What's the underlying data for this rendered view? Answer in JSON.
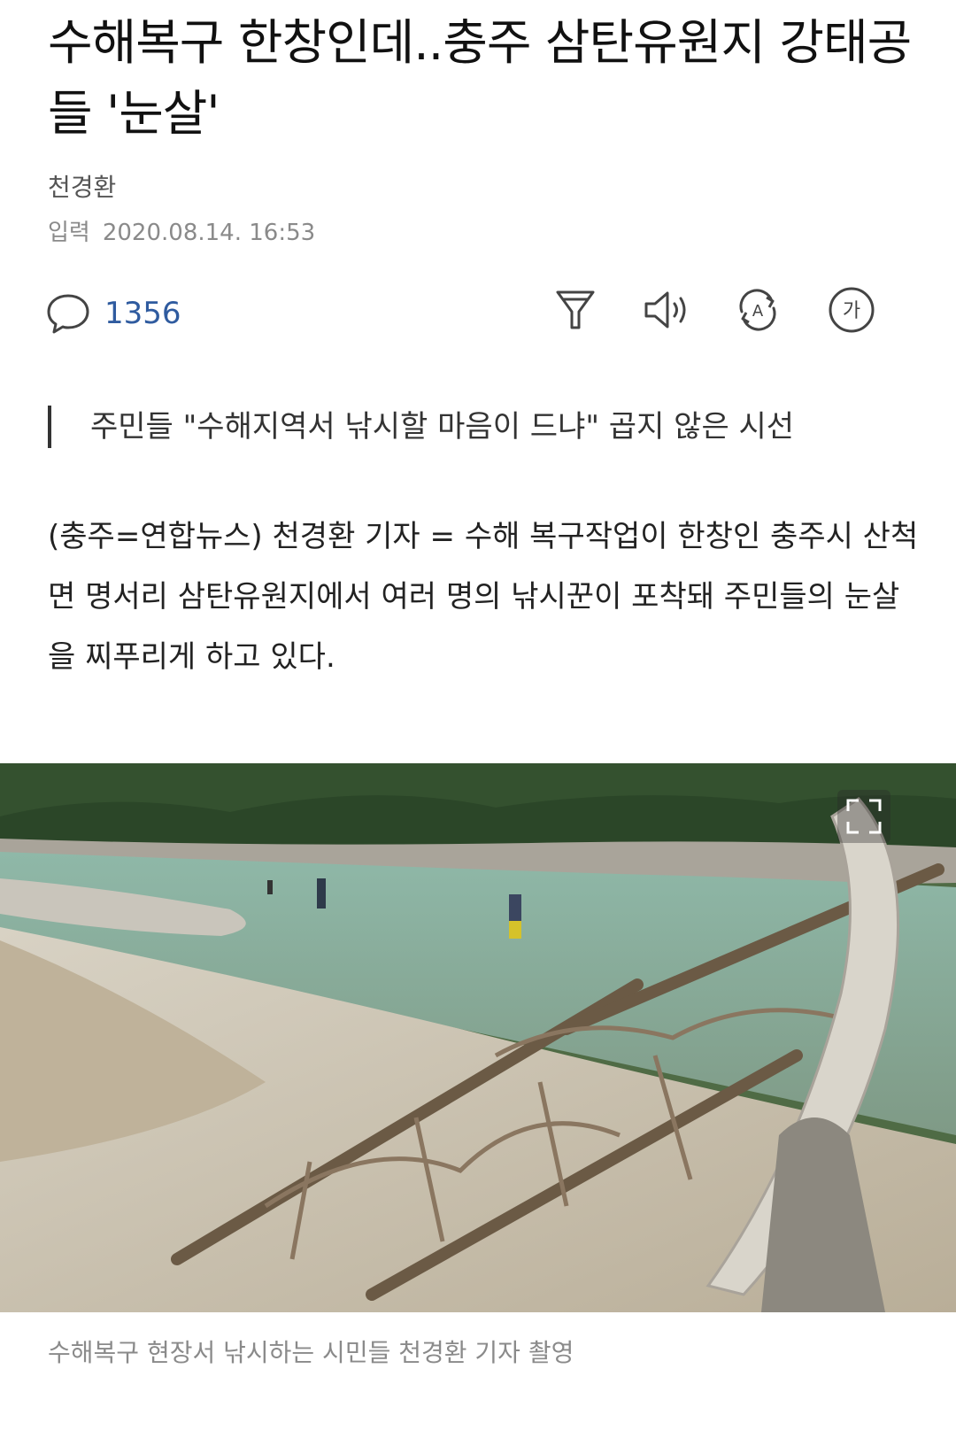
{
  "article": {
    "title": "수해복구 한창인데..충주 삼탄유원지 강태공들 '눈살'",
    "author": "천경환",
    "date_label": "입력",
    "date_value": "2020.08.14. 16:53",
    "comment_count": "1356",
    "subheading": "주민들 \"수해지역서 낚시할 마음이 드냐\" 곱지 않은 시선",
    "body": "(충주=연합뉴스) 천경환 기자 = 수해 복구작업이 한창인 충주시 산척면 명서리 삼탄유원지에서 여러 명의 낚시꾼이 포착돼 주민들의 눈살을 찌푸리게 하고 있다.",
    "photo_caption": "수해복구 현장서 낚시하는 시민들 천경환 기자 촬영"
  },
  "toolbar": {
    "icons": [
      "comment-icon",
      "summary-icon",
      "speaker-icon",
      "translate-icon",
      "font-size-icon"
    ],
    "font_size_glyph": "가",
    "translate_glyph": "A"
  },
  "colors": {
    "accent": "#2f5b9f",
    "muted": "#8a8a8a",
    "text": "#222222"
  }
}
